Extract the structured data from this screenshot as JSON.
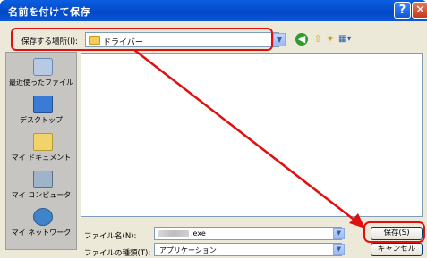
{
  "window": {
    "title": "名前を付けて保存",
    "help_icon": "?",
    "close_icon": "✕"
  },
  "location": {
    "label": "保存する場所(I):",
    "value": "ドライバー",
    "icons": [
      "folder-icon",
      "back-icon",
      "up-folder-icon",
      "new-folder-icon",
      "view-menu-icon"
    ]
  },
  "places": [
    {
      "name": "recent",
      "label": "最近使ったファイル",
      "icon": "recent-documents-icon"
    },
    {
      "name": "desktop",
      "label": "デスクトップ",
      "icon": "desktop-icon"
    },
    {
      "name": "my-documents",
      "label": "マイ ドキュメント",
      "icon": "my-documents-icon"
    },
    {
      "name": "my-computer",
      "label": "マイ コンピュータ",
      "icon": "my-computer-icon"
    },
    {
      "name": "network",
      "label": "マイ ネットワーク",
      "icon": "network-places-icon"
    }
  ],
  "form": {
    "filename_label": "ファイル名(N):",
    "filename_value": ".exe",
    "filetype_label": "ファイルの種類(T):",
    "filetype_value": "アプリケーション",
    "save_label": "保存(S)",
    "cancel_label": "キャンセル"
  },
  "annotation": {
    "color": "#e01010"
  }
}
